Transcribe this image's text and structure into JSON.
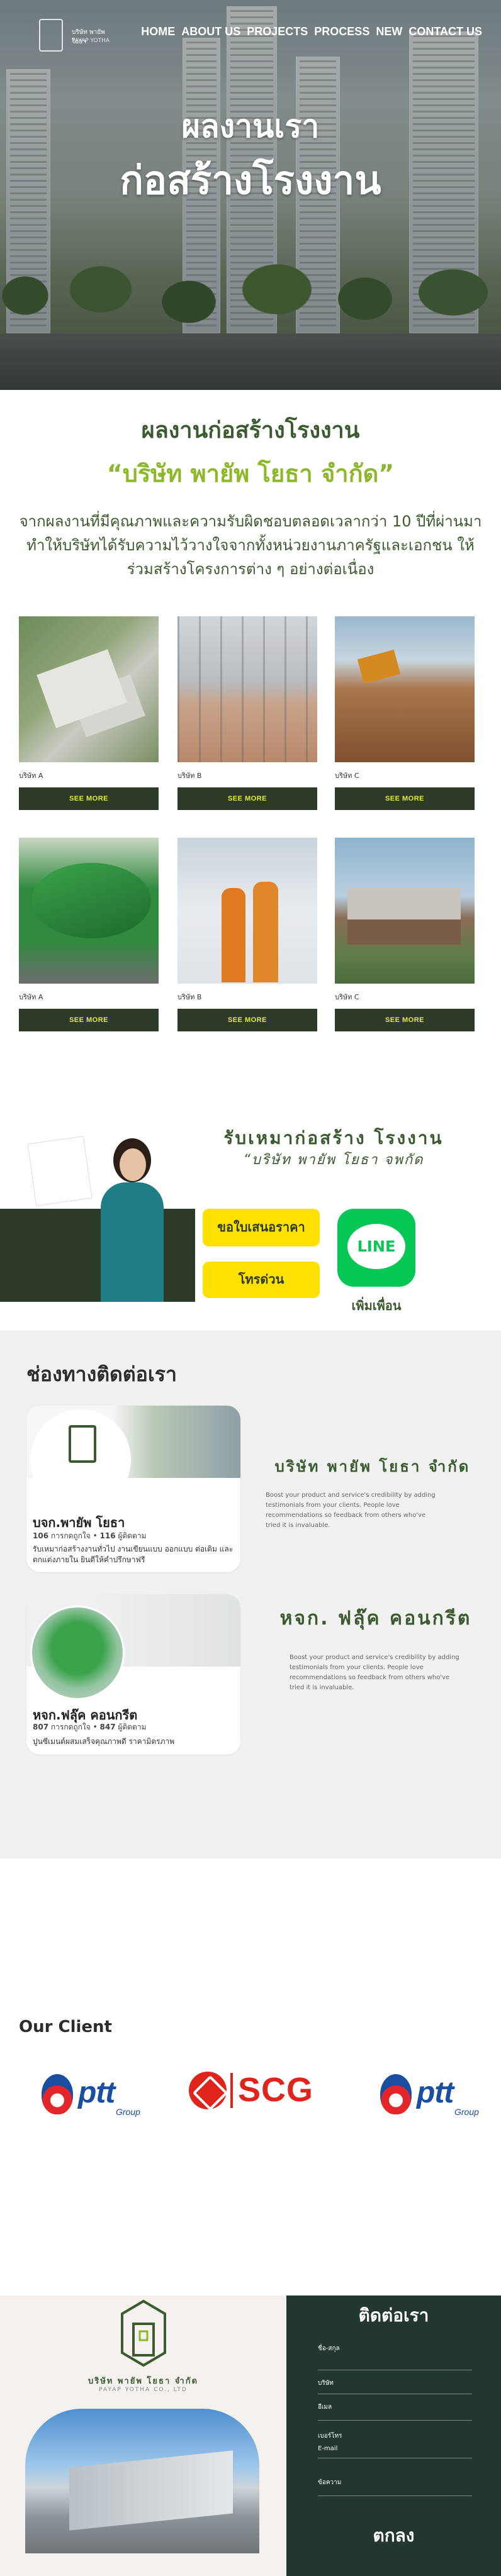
{
  "header": {
    "logo_line1": "บริษัท พายัพ โยธา",
    "logo_line2": "PAYAP YOTHA",
    "nav": [
      "HOME",
      "ABOUT US",
      "PROJECTS",
      "PROCESS",
      "NEW",
      "CONTACT US"
    ]
  },
  "hero": {
    "title_line1": "ผลงานเรา",
    "title_line2": "ก่อสร้างโรงงาน"
  },
  "intro": {
    "heading": "ผลงานก่อสร้างโรงงาน",
    "company": "“บริษัท พายัพ โยธา จำกัด”",
    "text": "จากผลงานที่มีคุณภาพและความรับผิดชอบตลอดเวลากว่า 10 ปีที่ผ่านมา ทำให้บริษัทได้รับความไว้วางใจจากทั้งหน่วยงานภาครัฐและเอกชน ให้ร่วมสร้างโครงการต่าง ๆ อย่างต่อเนื่อง"
  },
  "projects": [
    {
      "name": "บริษัท A",
      "button": "SEE MORE",
      "image": "aerial-factory"
    },
    {
      "name": "บริษัท B",
      "button": "SEE MORE",
      "image": "warehouse-interior"
    },
    {
      "name": "บริษัท C",
      "button": "SEE MORE",
      "image": "excavation-site"
    },
    {
      "name": "บริษัท A",
      "button": "SEE MORE",
      "image": "concrete-mixer"
    },
    {
      "name": "บริษัท B",
      "button": "SEE MORE",
      "image": "engineers"
    },
    {
      "name": "บริษัท C",
      "button": "SEE MORE",
      "image": "modern-house"
    }
  ],
  "banner": {
    "heading": "รับเหมาก่อสร้าง โรงงาน",
    "subheading": "“บริษัท พายัพ โยธา จพกัด",
    "quote_button": "ขอใบเสนอราคา",
    "call_button": "โทรด่วน",
    "line_logo": "LINE",
    "line_caption": "เพิ่มเพื่อน"
  },
  "contact": {
    "heading": "ช่องทางติดต่อเรา",
    "page1": {
      "name": "บจก.พายัพ โยธา",
      "likes": "106",
      "likes_label": "การกดถูกใจ",
      "followers": "116",
      "followers_label": "ผู้ติดตาม",
      "desc": "รับเหมาก่อสร้างงานทั่วไป งานเขียนแบบ ออกแบบ ต่อเติม และตกแต่งภายใน ยินดีให้คำปรึกษาฟรี"
    },
    "page1_right": {
      "title": "บริษัท พายัพ โยธา จำกัด",
      "desc": "Boost your product and service's credibility by adding testimonials from your clients. People love recommendations so feedback from others who've tried it is invaluable."
    },
    "page2": {
      "name": "หจก.ฟลุ๊ค คอนกรีต",
      "likes": "807",
      "likes_label": "การกดถูกใจ",
      "followers": "847",
      "followers_label": "ผู้ติดตาม",
      "desc": "ปูนซีเมนต์ผสมเสร็จคุณภาพดี ราคามิตรภาพ"
    },
    "page2_right": {
      "title": "หจก. ฟลุ๊ค คอนกรีต",
      "desc": "Boost your product and service's credibility by adding testimonials from your clients. People love recommendations so feedback from others who've tried it is invaluable."
    }
  },
  "clients": {
    "heading": "Our Client",
    "logos": [
      {
        "word": "ptt",
        "sub": "Group"
      },
      {
        "word": "SCG"
      },
      {
        "word": "ptt",
        "sub": "Group"
      }
    ]
  },
  "footer": {
    "company": "บริษัท พายัพ โยธา จำกัด",
    "company_en": "PAYAP YOTHA CO., LTD",
    "form_heading": "ติดต่อเรา",
    "fields": [
      "ชื่อ-สกุล",
      "บริษัท",
      "อีเมล",
      "เบอร์โทร",
      "E-mail",
      "ข้อความ"
    ],
    "submit": "ตกลง"
  },
  "colors": {
    "brand_green": "#3b5a30",
    "dark_green": "#2d3a28",
    "accent_lime": "#8cb82a",
    "yellow": "#ffe100",
    "line_green": "#06c755",
    "footer_dark": "#22372d"
  }
}
